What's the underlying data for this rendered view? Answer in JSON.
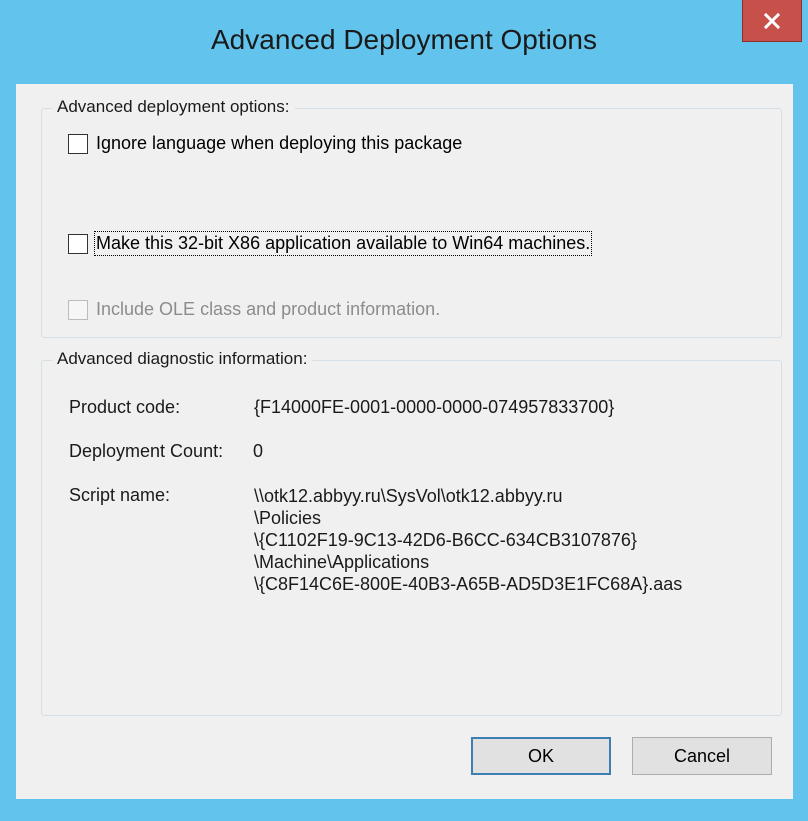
{
  "window": {
    "title": "Advanced Deployment Options"
  },
  "options_group": {
    "legend": "Advanced deployment options:",
    "checkboxes": [
      {
        "label": "Ignore language when deploying this package",
        "checked": false,
        "enabled": true
      },
      {
        "label": "Make this 32-bit X86 application available to Win64 machines.",
        "checked": false,
        "enabled": true,
        "focused": true
      },
      {
        "label": "Include OLE class and product information.",
        "checked": false,
        "enabled": false
      }
    ]
  },
  "diagnostic_group": {
    "legend": "Advanced diagnostic information:",
    "product_code_label": "Product code:",
    "product_code_value": "{F14000FE-0001-0000-0000-074957833700}",
    "deployment_count_label": "Deployment Count:",
    "deployment_count_value": "0",
    "script_name_label": "Script name:",
    "script_name_lines": [
      "\\\\otk12.abbyy.ru\\SysVol\\otk12.abbyy.ru",
      "\\Policies",
      "\\{C1102F19-9C13-42D6-B6CC-634CB3107876}",
      "\\Machine\\Applications",
      "\\{C8F14C6E-800E-40B3-A65B-AD5D3E1FC68A}.aas"
    ]
  },
  "buttons": {
    "ok_label": "OK",
    "cancel_label": "Cancel"
  },
  "icons": {
    "close": "close-icon"
  },
  "colors": {
    "title_bar": "#62c3ec",
    "close_button": "#c7504b",
    "client_background": "#f0f0f0",
    "default_button_border": "#3c7fb1"
  }
}
